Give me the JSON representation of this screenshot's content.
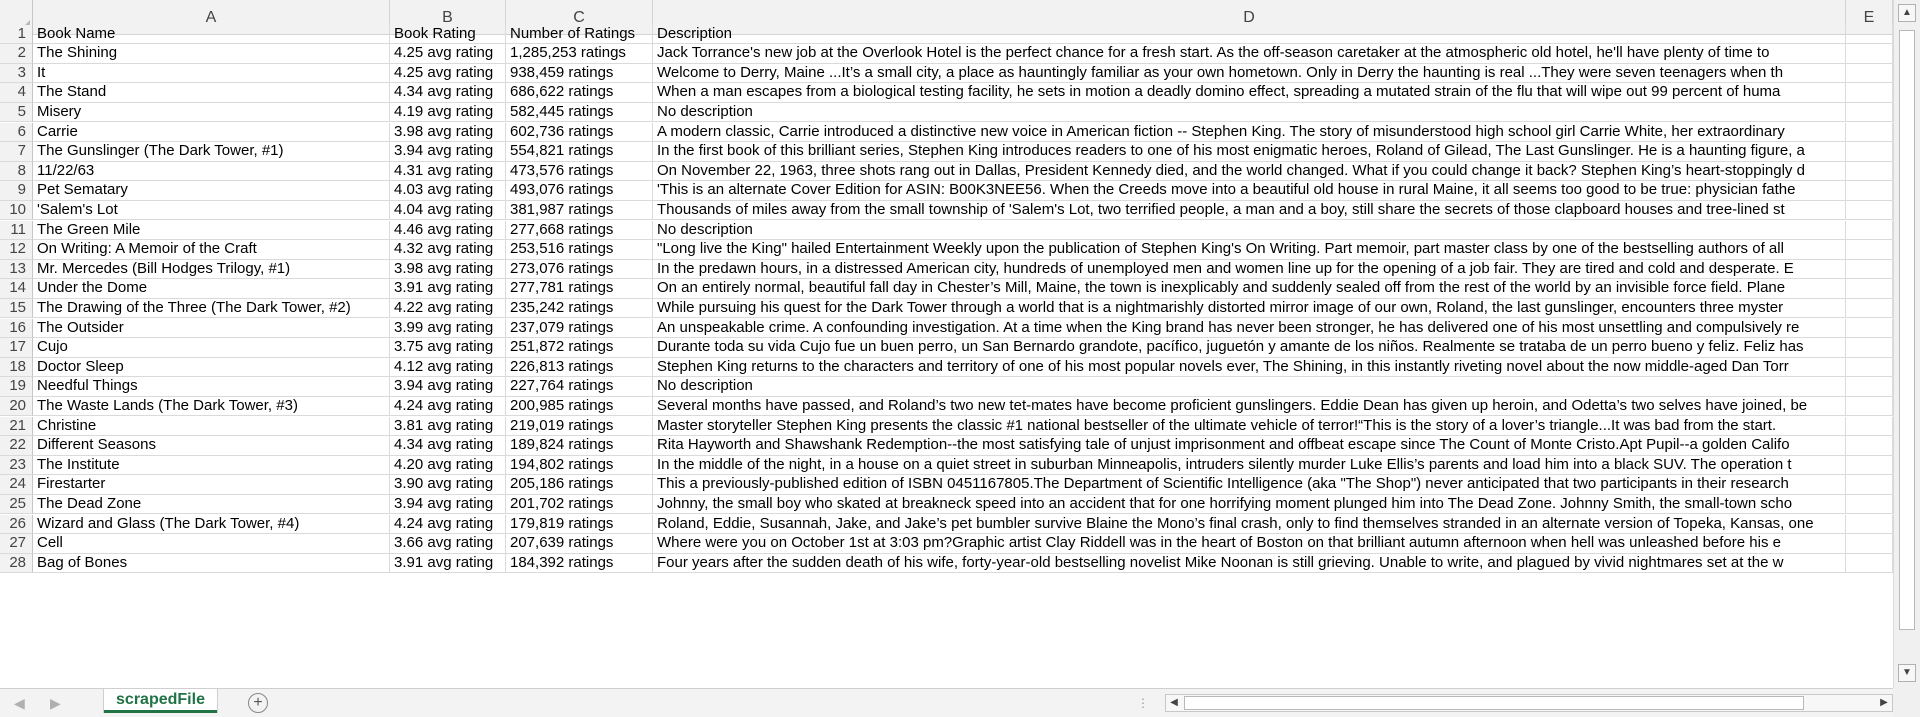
{
  "sheet": {
    "columns": [
      "A",
      "B",
      "C",
      "D",
      "E"
    ],
    "rows": [
      {
        "n": "1",
        "a": "Book Name",
        "b": "Book Rating",
        "c": "Number of Ratings",
        "d": "Description"
      },
      {
        "n": "2",
        "a": "The Shining",
        "b": "4.25 avg rating",
        "c": "1,285,253 ratings",
        "d": "Jack Torrance's new job at the Overlook Hotel is the perfect chance for a fresh start. As the off-season caretaker at the atmospheric old hotel, he'll have plenty of time to"
      },
      {
        "n": "3",
        "a": "It",
        "b": "4.25 avg rating",
        "c": "938,459 ratings",
        "d": "Welcome to Derry, Maine ...It’s a small city, a place as hauntingly familiar as your own hometown. Only in Derry the haunting is real ...They were seven teenagers when th"
      },
      {
        "n": "4",
        "a": "The Stand",
        "b": "4.34 avg rating",
        "c": "686,622 ratings",
        "d": "When a man escapes from a biological testing facility, he sets in motion a deadly domino effect, spreading a mutated strain of the flu that will wipe out 99 percent of huma"
      },
      {
        "n": "5",
        "a": "Misery",
        "b": "4.19 avg rating",
        "c": "582,445 ratings",
        "d": "No description"
      },
      {
        "n": "6",
        "a": "Carrie",
        "b": "3.98 avg rating",
        "c": "602,736 ratings",
        "d": "A modern classic, Carrie introduced a distinctive new voice in American fiction -- Stephen King. The story of misunderstood high school girl Carrie White, her extraordinary"
      },
      {
        "n": "7",
        "a": "The Gunslinger (The Dark Tower, #1)",
        "b": "3.94 avg rating",
        "c": "554,821 ratings",
        "d": "In the first book of this brilliant series, Stephen King introduces readers to one of his most enigmatic heroes, Roland of Gilead, The Last Gunslinger. He is a haunting figure, a"
      },
      {
        "n": "8",
        "a": "11/22/63",
        "b": "4.31 avg rating",
        "c": "473,576 ratings",
        "d": "On November 22, 1963, three shots rang out in Dallas, President Kennedy died, and the world changed. What if you could change it back? Stephen King’s heart-stoppingly d"
      },
      {
        "n": "9",
        "a": "Pet Sematary",
        "b": "4.03 avg rating",
        "c": "493,076 ratings",
        "d": "'This is an alternate Cover Edition for ASIN: B00K3NEE56. When the Creeds move into a beautiful old house in rural Maine, it all seems too good to be true: physician fathe"
      },
      {
        "n": "10",
        "a": "'Salem's Lot",
        "b": "4.04 avg rating",
        "c": "381,987 ratings",
        "d": "Thousands of miles away from the small township of 'Salem's Lot, two terrified people, a man and a boy, still share the secrets of those clapboard houses and tree-lined st"
      },
      {
        "n": "11",
        "a": "The Green Mile",
        "b": "4.46 avg rating",
        "c": "277,668 ratings",
        "d": "No description"
      },
      {
        "n": "12",
        "a": "On Writing: A Memoir of the Craft",
        "b": "4.32 avg rating",
        "c": "253,516 ratings",
        "d": "\"Long live the King\" hailed Entertainment Weekly upon the publication of Stephen King's On Writing. Part memoir, part master class by one of the bestselling authors of all"
      },
      {
        "n": "13",
        "a": "Mr. Mercedes (Bill Hodges Trilogy, #1)",
        "b": "3.98 avg rating",
        "c": "273,076 ratings",
        "d": "In the predawn hours, in a distressed American city, hundreds of unemployed men and women line up for the opening of a job fair. They are tired and cold and desperate. E"
      },
      {
        "n": "14",
        "a": "Under the Dome",
        "b": "3.91 avg rating",
        "c": "277,781 ratings",
        "d": "On an entirely normal, beautiful fall day in Chester’s Mill, Maine, the town is inexplicably and suddenly sealed off from the rest of the world by an invisible force field. Plane"
      },
      {
        "n": "15",
        "a": "The Drawing of the Three (The Dark Tower, #2)",
        "b": "4.22 avg rating",
        "c": "235,242 ratings",
        "d": "While pursuing his quest for the Dark Tower through a world that is a nightmarishly distorted mirror image of our own, Roland, the last gunslinger, encounters three myster"
      },
      {
        "n": "16",
        "a": "The Outsider",
        "b": "3.99 avg rating",
        "c": "237,079 ratings",
        "d": "An unspeakable crime. A confounding investigation. At a time when the King brand has never been stronger, he has delivered one of his most unsettling and compulsively re"
      },
      {
        "n": "17",
        "a": "Cujo",
        "b": "3.75 avg rating",
        "c": "251,872 ratings",
        "d": "Durante toda su vida Cujo fue un buen perro, un San Bernardo grandote, pacífico, juguetón y amante de los niños. Realmente se trataba de un perro bueno y feliz. Feliz has"
      },
      {
        "n": "18",
        "a": "Doctor Sleep",
        "b": "4.12 avg rating",
        "c": "226,813 ratings",
        "d": "Stephen King returns to the characters and territory of one of his most popular novels ever, The Shining, in this instantly riveting novel about the now middle-aged Dan Torr"
      },
      {
        "n": "19",
        "a": "Needful Things",
        "b": "3.94 avg rating",
        "c": "227,764 ratings",
        "d": "No description"
      },
      {
        "n": "20",
        "a": "The Waste Lands (The Dark Tower, #3)",
        "b": "4.24 avg rating",
        "c": "200,985 ratings",
        "d": "Several months have passed, and Roland’s two new tet-mates have become proficient gunslingers. Eddie Dean has given up heroin, and Odetta’s two selves have joined, be"
      },
      {
        "n": "21",
        "a": "Christine",
        "b": "3.81 avg rating",
        "c": "219,019 ratings",
        "d": "Master storyteller Stephen King presents the classic #1 national bestseller of the ultimate vehicle of terror!“This is the story of a lover’s triangle...It was bad from the start."
      },
      {
        "n": "22",
        "a": "Different Seasons",
        "b": "4.34 avg rating",
        "c": "189,824 ratings",
        "d": "Rita Hayworth and Shawshank Redemption--the most satisfying tale of unjust imprisonment and offbeat escape since The Count of Monte Cristo.Apt Pupil--a golden Califo"
      },
      {
        "n": "23",
        "a": "The Institute",
        "b": "4.20 avg rating",
        "c": "194,802 ratings",
        "d": "In the middle of the night, in a house on a quiet street in suburban Minneapolis, intruders silently murder Luke Ellis’s parents and load him into a black SUV. The operation t"
      },
      {
        "n": "24",
        "a": "Firestarter",
        "b": "3.90 avg rating",
        "c": "205,186 ratings",
        "d": "This a previously-published edition of ISBN 0451167805.The Department of Scientific Intelligence (aka \"The Shop\") never anticipated that two participants in their research"
      },
      {
        "n": "25",
        "a": "The Dead Zone",
        "b": "3.94 avg rating",
        "c": "201,702 ratings",
        "d": "Johnny, the small boy who skated at breakneck speed into an accident that for one horrifying moment plunged him into The Dead Zone. Johnny Smith, the small-town scho"
      },
      {
        "n": "26",
        "a": "Wizard and Glass (The Dark Tower, #4)",
        "b": "4.24 avg rating",
        "c": "179,819 ratings",
        "d": "Roland, Eddie, Susannah, Jake, and Jake’s pet bumbler survive Blaine the Mono’s final crash, only to find themselves stranded in an alternate version of Topeka, Kansas, one"
      },
      {
        "n": "27",
        "a": "Cell",
        "b": "3.66 avg rating",
        "c": "207,639 ratings",
        "d": "Where were you on October 1st at 3:03 pm?Graphic artist Clay Riddell was in the heart of Boston on that brilliant autumn afternoon when hell was unleashed before his e"
      },
      {
        "n": "28",
        "a": "Bag of Bones",
        "b": "3.91 avg rating",
        "c": "184,392 ratings",
        "d": "Four years after the sudden death of his wife, forty-year-old bestselling novelist Mike Noonan is still grieving. Unable to write, and plagued by vivid nightmares set at the w"
      }
    ]
  },
  "tabs": {
    "active_label": "scrapedFile",
    "add_symbol": "+",
    "prev_symbol": "◀",
    "next_symbol": "▶",
    "splitter": "⋮"
  },
  "scroll": {
    "up": "▲",
    "down": "▼",
    "left": "◀",
    "right": "▶"
  },
  "colors": {
    "accent": "#217346",
    "grid": "#dadada",
    "header_bg": "#f2f2f2"
  }
}
